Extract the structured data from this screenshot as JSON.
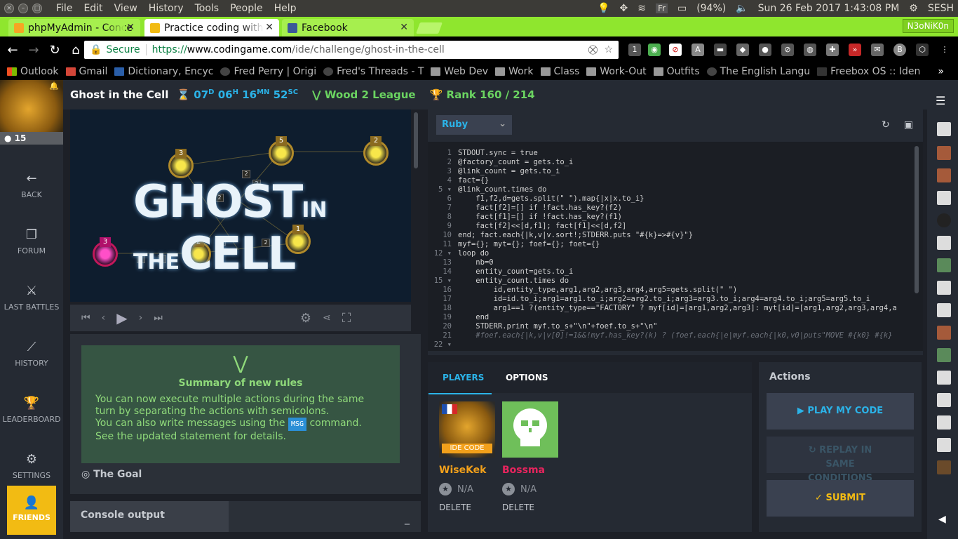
{
  "os": {
    "menu": [
      "File",
      "Edit",
      "View",
      "History",
      "Tools",
      "People",
      "Help"
    ],
    "battery": "(94%)",
    "datetime": "Sun 26 Feb 2017  1:43:08 PM",
    "user": "SESH",
    "fr_label": "Fr"
  },
  "browser": {
    "tabs": [
      {
        "label": "phpMyAdmin - Conce",
        "active": false
      },
      {
        "label": "Practice coding with",
        "active": true
      },
      {
        "label": "Facebook",
        "active": false
      }
    ],
    "profile": "N3oNiK0n",
    "secure_label": "Secure",
    "url_scheme": "https://",
    "url_domain": "www.codingame.com",
    "url_path": "/ide/challenge/ghost-in-the-cell",
    "bookmarks": [
      "Outlook",
      "Gmail",
      "Dictionary, Encyc",
      "Fred Perry | Origi",
      "Fred's Threads - T",
      "Web Dev",
      "Work",
      "Class",
      "Work-Out",
      "Outfits",
      "The English Langu",
      "Freebox OS :: Iden"
    ],
    "more": "»"
  },
  "sidebar": {
    "level": "15",
    "items": [
      {
        "label": "BACK",
        "icon": "arrow-left-icon"
      },
      {
        "label": "FORUM",
        "icon": "forum-icon"
      },
      {
        "label": "LAST BATTLES",
        "icon": "battles-icon"
      },
      {
        "label": "HISTORY",
        "icon": "history-icon"
      },
      {
        "label": "LEADERBOARD",
        "icon": "trophy-icon"
      },
      {
        "label": "SETTINGS",
        "icon": "gear-icon"
      }
    ],
    "friends": "FRIENDS"
  },
  "header": {
    "title": "Ghost in the Cell",
    "timer": {
      "d": "07",
      "h": "06",
      "mn": "16",
      "sc": "52"
    },
    "timer_units": {
      "d": "D",
      "h": "H",
      "mn": "MN",
      "sc": "SC"
    },
    "league": "Wood 2 League",
    "rank": "Rank 160 / 214"
  },
  "game": {
    "title_main": "GHOST",
    "title_small": "IN THE",
    "title_end": "CELL"
  },
  "rules": {
    "title": "Summary of new rules",
    "line1": "You can now execute multiple actions during the same turn by separating the actions with semicolons.",
    "line2a": "You can also write messages using the",
    "msg": "MSG",
    "line2b": "command.",
    "line3": "See the updated statement for details.",
    "goal": "The Goal"
  },
  "console": {
    "label": "Console output",
    "minimize": "_"
  },
  "editor": {
    "language": "Ruby",
    "line_numbers": [
      "1",
      "2",
      "3",
      "4",
      "5",
      "6",
      "7",
      "8",
      "9",
      "10",
      "11",
      "12",
      "13",
      "14",
      "15",
      "16",
      "17",
      "18",
      "19",
      "20",
      "21",
      "22"
    ],
    "lines": [
      "STDOUT.sync = true",
      "@factory_count = gets.to_i",
      "@link_count = gets.to_i",
      "fact={}",
      "@link_count.times do",
      "    f1,f2,d=gets.split(\" \").map{|x|x.to_i}",
      "    fact[f2]=[] if !fact.has_key?(f2)",
      "    fact[f1]=[] if !fact.has_key?(f1)",
      "    fact[f2]<<[d,f1]; fact[f1]<<[d,f2]",
      "end; fact.each{|k,v|v.sort!;STDERR.puts \"#{k}=>#{v}\"}",
      "myf={}; myt={}; foef={}; foet={}",
      "loop do",
      "    nb=0",
      "    entity_count=gets.to_i",
      "    entity_count.times do",
      "        id,entity_type,arg1,arg2,arg3,arg4,arg5=gets.split(\" \")",
      "        id=id.to_i;arg1=arg1.to_i;arg2=arg2.to_i;arg3=arg3.to_i;arg4=arg4.to_i;arg5=arg5.to_i",
      "        arg1==1 ?(entity_type==\"FACTORY\" ? myf[id]=[arg1,arg2,arg3]: myt[id]=[arg1,arg2,arg3,arg4,a",
      "    end",
      "    STDERR.print myf.to_s+\"\\n\"+foef.to_s+\"\\n\"",
      "    #foef.each{|k,v|v[0]!=1&&!myf.has_key?(k) ? (foef.each{|e|myf.each{|k0,v0|puts\"MOVE #{k0} #{k}",
      ""
    ]
  },
  "players_panel": {
    "tab_players": "PLAYERS",
    "tab_options": "OPTIONS",
    "players": [
      {
        "name": "WiseKek",
        "tag": "IDE CODE",
        "score": "N/A",
        "delete": "DELETE",
        "color": "#f2a01b"
      },
      {
        "name": "Bossma",
        "score": "N/A",
        "delete": "DELETE",
        "color": "#e8245e"
      }
    ]
  },
  "actions": {
    "title": "Actions",
    "play": "PLAY MY CODE",
    "replay": "REPLAY IN SAME CONDITIONS",
    "submit": "SUBMIT"
  },
  "colors": {
    "accent_blue": "#2bb3e8",
    "accent_green": "#6bd461",
    "gold": "#f2bb13",
    "chrome_green": "#8fe62e"
  }
}
